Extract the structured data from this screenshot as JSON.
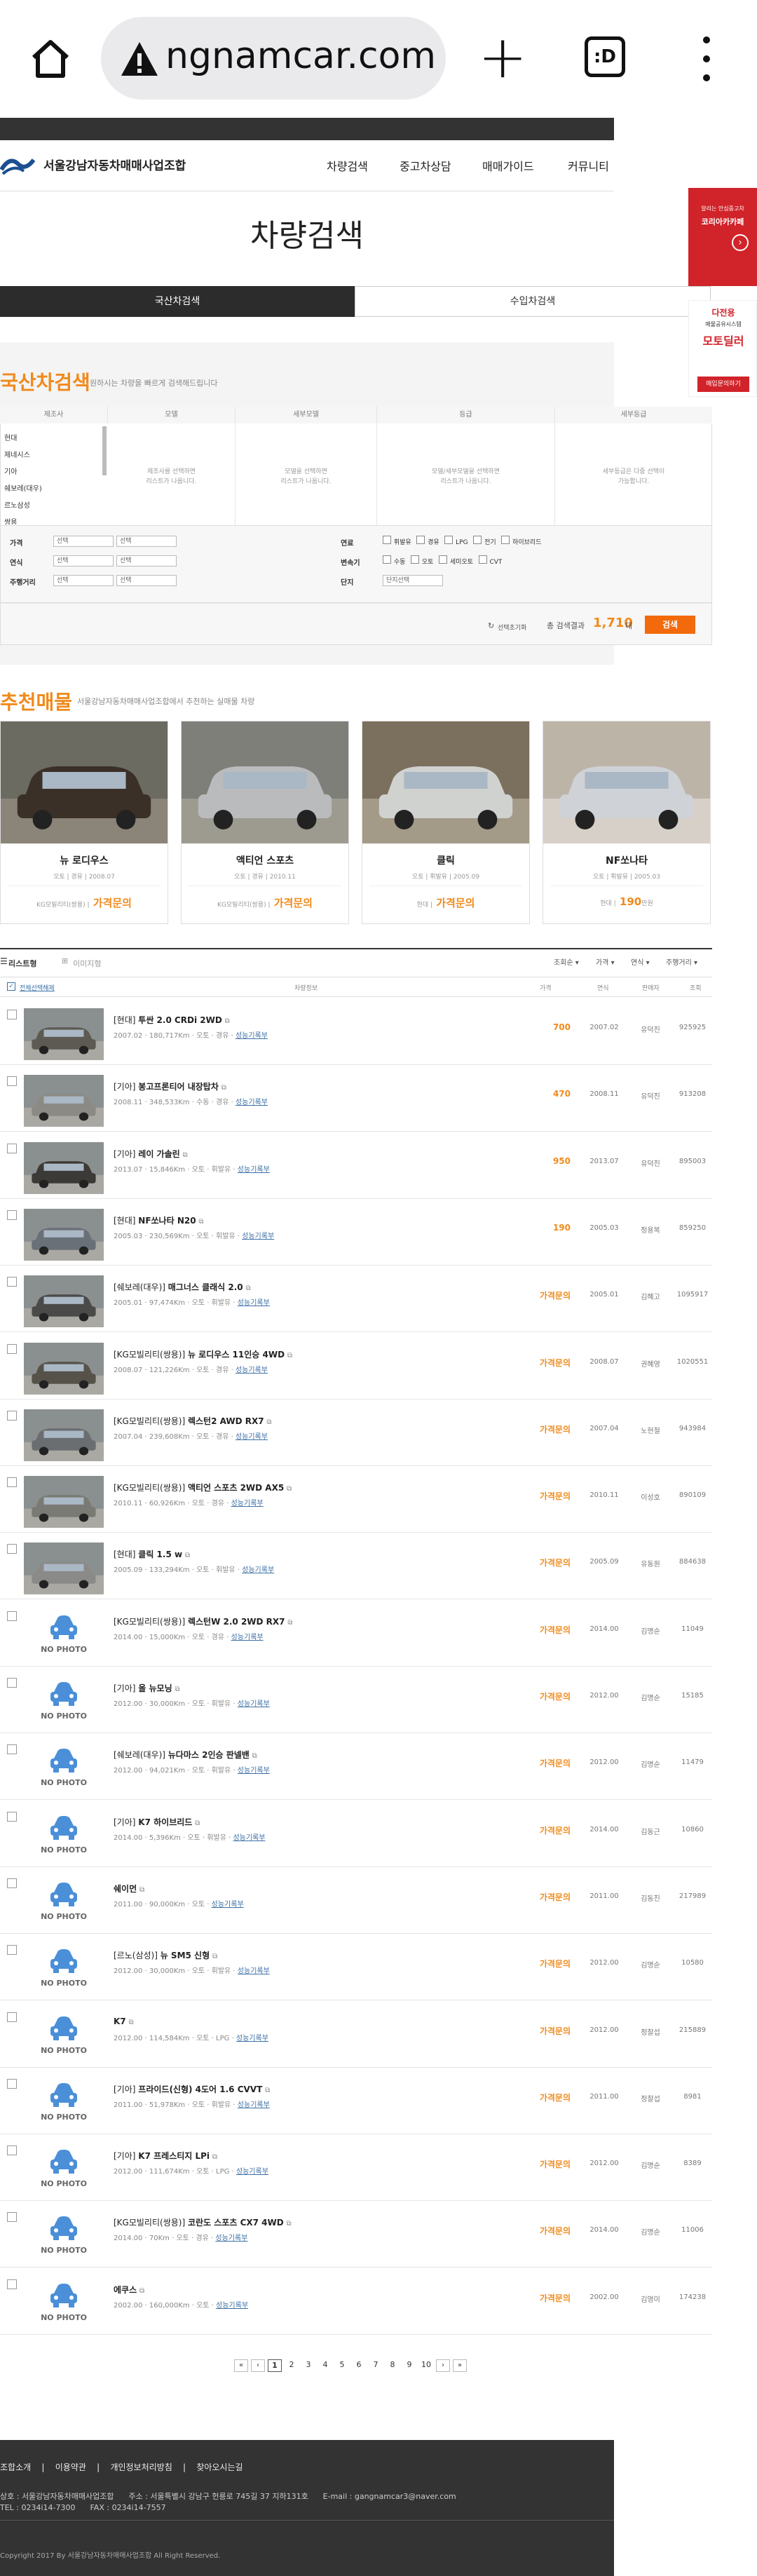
{
  "browser": {
    "url": "ngnamcar.com",
    "tabs_label": ":D"
  },
  "header": {
    "logo_text": "서울강남자동차매매사업조합",
    "nav": [
      "차량검색",
      "중고차상담",
      "매매가이드",
      "커뮤니티"
    ]
  },
  "page_title": "차량검색",
  "tabs": [
    "국산차검색",
    "수입차검색"
  ],
  "search": {
    "title": "국산차검색",
    "subtitle": "원하시는 차량을 빠르게 검색해드립니다",
    "columns": [
      "제조사",
      "모델",
      "세부모델",
      "등급",
      "세부등급"
    ],
    "column_hints": [
      "",
      "제조사를 선택하면\n리스트가 나옵니다.",
      "모델을 선택하면\n리스트가 나옵니다.",
      "모델/세부모델을 선택하면\n리스트가 나옵니다.",
      "세부등급은 다중 선택이\n가능합니다."
    ],
    "manufacturers": [
      "현대",
      "제네시스",
      "기아",
      "쉐보레(대우)",
      "르노삼성",
      "쌍용"
    ],
    "filters": {
      "price": "가격",
      "year": "연식",
      "mileage": "주행거리",
      "fuel": "연료",
      "transmission": "변속기",
      "unit": "단지",
      "select_placeholder": "선택",
      "unit_placeholder": "단지선택"
    },
    "fuel_options": [
      "휘발유",
      "경유",
      "LPG",
      "전기",
      "하이브리드"
    ],
    "trans_options": [
      "수동",
      "오토",
      "세미오토",
      "CVT"
    ],
    "reset_label": "선택초기화",
    "result_label": "총 검색결과",
    "result_count": "1,710",
    "result_unit": "대",
    "search_button": "검색"
  },
  "recommended": {
    "title": "추천매물",
    "subtitle": "서울강남자동차매매사업조합에서 추천하는 실매물 차량",
    "items": [
      {
        "name": "뉴 로디우스",
        "meta": "오토 | 경유 | 2008.07",
        "seller": "KG모빌리티(쌍용) |",
        "price": "가격문의"
      },
      {
        "name": "액티언 스포츠",
        "meta": "오토 | 경유 | 2010.11",
        "seller": "KG모빌리티(쌍용) |",
        "price": "가격문의"
      },
      {
        "name": "클릭",
        "meta": "오토 | 휘발유 | 2005.09",
        "seller": "현대 |",
        "price": "가격문의"
      },
      {
        "name": "NF쏘나타",
        "meta": "오토 | 휘발유 | 2005.03",
        "seller": "현대 |",
        "price": "190",
        "price_unit": "만원"
      }
    ]
  },
  "list": {
    "view_list": "리스트형",
    "view_gallery": "이미지형",
    "sorts": [
      "조회순",
      "가격",
      "연식",
      "주행거리"
    ],
    "headers": [
      "전체선택해제",
      "차량정보",
      "가격",
      "연식",
      "판매자",
      "조회"
    ],
    "rows": [
      {
        "maker": "[현대]",
        "model": "투싼 2.0 CRDi 2WD",
        "info": "2007.02 · 180,717Km · 오토 · 경유 · ",
        "link": "성능기록부",
        "price": "700",
        "year": "2007.02",
        "seller": "유덕진",
        "views": "925925",
        "photo": true
      },
      {
        "maker": "[기아]",
        "model": "봉고프론티어 내장탑차",
        "info": "2008.11 · 348,533Km · 수동 · 경유 · ",
        "link": "성능기록부",
        "price": "470",
        "year": "2008.11",
        "seller": "유덕진",
        "views": "913208",
        "photo": true
      },
      {
        "maker": "[기아]",
        "model": "레이 가솔린",
        "info": "2013.07 · 15,846Km · 오토 · 휘발유 · ",
        "link": "성능기록부",
        "price": "950",
        "year": "2013.07",
        "seller": "유덕진",
        "views": "895003",
        "photo": true
      },
      {
        "maker": "[현대]",
        "model": "NF쏘나타 N20",
        "info": "2005.03 · 230,569Km · 오토 · 휘발유 · ",
        "link": "성능기록부",
        "price": "190",
        "year": "2005.03",
        "seller": "정용복",
        "views": "859250",
        "photo": true
      },
      {
        "maker": "[쉐보레(대우)]",
        "model": "매그너스 클래식 2.0",
        "info": "2005.01 · 97,474Km · 오토 · 휘발유 · ",
        "link": "성능기록부",
        "price": "가격문의",
        "year": "2005.01",
        "seller": "김혜고",
        "views": "1095917",
        "photo": true
      },
      {
        "maker": "[KG모빌리티(쌍용)]",
        "model": "뉴 로디우스 11인승 4WD",
        "info": "2008.07 · 121,226Km · 오토 · 경유 · ",
        "link": "성능기록부",
        "price": "가격문의",
        "year": "2008.07",
        "seller": "권혜영",
        "views": "1020551",
        "photo": true
      },
      {
        "maker": "[KG모빌리티(쌍용)]",
        "model": "렉스턴2 AWD RX7",
        "info": "2007.04 · 239,608Km · 오토 · 경유 · ",
        "link": "성능기록부",
        "price": "가격문의",
        "year": "2007.04",
        "seller": "노현철",
        "views": "943984",
        "photo": true
      },
      {
        "maker": "[KG모빌리티(쌍용)]",
        "model": "액티언 스포츠 2WD AX5",
        "info": "2010.11 · 60,926Km · 오토 · 경유 · ",
        "link": "성능기록부",
        "price": "가격문의",
        "year": "2010.11",
        "seller": "이성호",
        "views": "890109",
        "photo": true
      },
      {
        "maker": "[현대]",
        "model": "클릭 1.5 w",
        "info": "2005.09 · 133,294Km · 오토 · 휘발유 · ",
        "link": "성능기록부",
        "price": "가격문의",
        "year": "2005.09",
        "seller": "유동원",
        "views": "884638",
        "photo": true
      },
      {
        "maker": "[KG모빌리티(쌍용)]",
        "model": "렉스턴W 2.0 2WD RX7",
        "info": "2014.00 · 15,000Km · 오토 · 경유 · ",
        "link": "성능기록부",
        "price": "가격문의",
        "year": "2014.00",
        "seller": "김명순",
        "views": "11049",
        "photo": false
      },
      {
        "maker": "[기아]",
        "model": "올 뉴모닝",
        "info": "2012.00 · 30,000Km · 오토 · 휘발유 · ",
        "link": "성능기록부",
        "price": "가격문의",
        "year": "2012.00",
        "seller": "김명순",
        "views": "15185",
        "photo": false
      },
      {
        "maker": "[쉐보레(대우)]",
        "model": "뉴다마스 2인승 판넬밴",
        "info": "2012.00 · 94,021Km · 오토 · 휘발유 · ",
        "link": "성능기록부",
        "price": "가격문의",
        "year": "2012.00",
        "seller": "김명순",
        "views": "11479",
        "photo": false
      },
      {
        "maker": "[기아]",
        "model": "K7 하이브리드",
        "info": "2014.00 · 5,396Km · 오토 · 휘발유 · ",
        "link": "성능기록부",
        "price": "가격문의",
        "year": "2014.00",
        "seller": "김동근",
        "views": "10860",
        "photo": false
      },
      {
        "maker": "",
        "model": "쉐이먼",
        "info": "2011.00 · 90,000Km · 오토 · ",
        "link": "성능기록부",
        "price": "가격문의",
        "year": "2011.00",
        "seller": "김동진",
        "views": "217989",
        "photo": false
      },
      {
        "maker": "[르노(삼성)]",
        "model": "뉴 SM5 신형",
        "info": "2012.00 · 30,000Km · 오토 · 휘발유 · ",
        "link": "성능기록부",
        "price": "가격문의",
        "year": "2012.00",
        "seller": "김명순",
        "views": "10580",
        "photo": false
      },
      {
        "maker": "",
        "model": "K7",
        "info": "2012.00 · 114,584Km · 오토 · LPG · ",
        "link": "성능기록부",
        "price": "가격문의",
        "year": "2012.00",
        "seller": "정찰섭",
        "views": "215889",
        "photo": false
      },
      {
        "maker": "[기아]",
        "model": "프라이드(신형) 4도어 1.6 CVVT",
        "info": "2011.00 · 51,978Km · 오토 · 휘발유 · ",
        "link": "성능기록부",
        "price": "가격문의",
        "year": "2011.00",
        "seller": "정찰섭",
        "views": "8981",
        "photo": false
      },
      {
        "maker": "[기아]",
        "model": "K7 프레스티지 LPi",
        "info": "2012.00 · 111,674Km · 오토 · LPG · ",
        "link": "성능기록부",
        "price": "가격문의",
        "year": "2012.00",
        "seller": "김명순",
        "views": "8389",
        "photo": false
      },
      {
        "maker": "[KG모빌리티(쌍용)]",
        "model": "코란도 스포츠 CX7 4WD",
        "info": "2014.00 · 70Km · 오토 · 경유 · ",
        "link": "성능기록부",
        "price": "가격문의",
        "year": "2014.00",
        "seller": "김명순",
        "views": "11006",
        "photo": false
      },
      {
        "maker": "",
        "model": "에쿠스",
        "info": "2002.00 · 160,000Km · 오토 · ",
        "link": "성능기록부",
        "price": "가격문의",
        "year": "2002.00",
        "seller": "김영미",
        "views": "174238",
        "photo": false
      }
    ],
    "no_photo": "NO PHOTO"
  },
  "pagination": {
    "first": "«",
    "prev": "‹",
    "pages": [
      "1",
      "2",
      "3",
      "4",
      "5",
      "6",
      "7",
      "8",
      "9",
      "10"
    ],
    "current": "1",
    "next": "›",
    "last": "»"
  },
  "footer": {
    "nav": "조합소개    |    이용약관    |    개인정보처리방침    |    찾아오시는길",
    "address": "상호 : 서울강남자동차매매사업조합      주소 : 서울특별시 강남구 헌릉로 745길 37 지하131호      E-mail : gangnamcar3@naver.com",
    "tel": "TEL : 0234i14-7300      FAX : 0234i14-7557",
    "copyright": "Copyright 2017 By 서울강남자동차매매사업조합 All Right Reserved."
  },
  "banners": {
    "ban1_top": "알리는 안심중고차",
    "ban1_main": "코리아카카페",
    "ban2_top": "다전용",
    "ban2_sub": "매물공유시스템",
    "ban2_main": "모토딜러",
    "ban2_bottom": "매입문의하기"
  },
  "colors": {
    "accent": "#f08a1c",
    "button": "#f26a0c",
    "dark": "#333333",
    "link": "#3a6ea5"
  }
}
